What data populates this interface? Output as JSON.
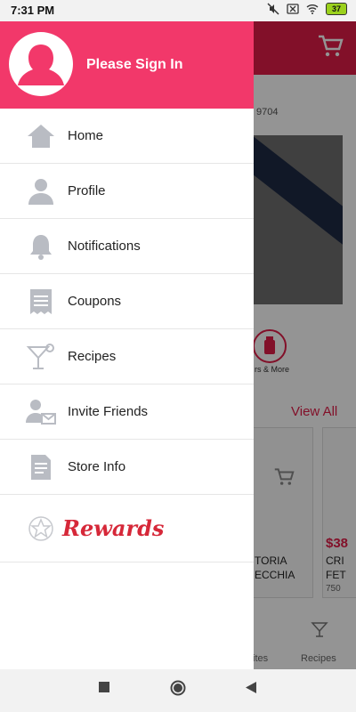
{
  "status_bar": {
    "time": "7:31 PM",
    "battery": "37"
  },
  "background": {
    "address_snippet": "9704",
    "category_label": "rs & More",
    "view_all": "View All",
    "price": "$38",
    "product1": [
      "TORIA",
      "ECCHIA"
    ],
    "product2": [
      "CRI",
      "FET"
    ],
    "product2_size": "750",
    "tab_favorites": "ites",
    "tab_recipes": "Recipes"
  },
  "drawer": {
    "sign_in": "Please Sign In",
    "menu": [
      {
        "label": "Home",
        "icon": "home-icon"
      },
      {
        "label": "Profile",
        "icon": "profile-icon"
      },
      {
        "label": "Notifications",
        "icon": "bell-icon"
      },
      {
        "label": "Coupons",
        "icon": "coupon-icon"
      },
      {
        "label": "Recipes",
        "icon": "cocktail-icon"
      },
      {
        "label": "Invite Friends",
        "icon": "invite-icon"
      },
      {
        "label": "Store Info",
        "icon": "document-icon"
      }
    ],
    "rewards": "Rewards"
  },
  "colors": {
    "header": "#f2386a",
    "brand_red": "#e11d48",
    "rewards_red": "#d62839",
    "icon_gray": "#b9bcc3"
  }
}
